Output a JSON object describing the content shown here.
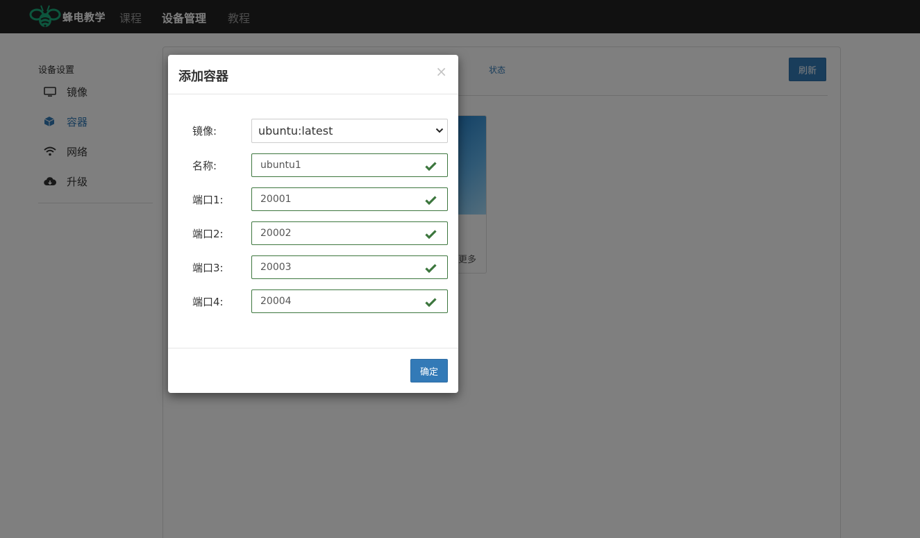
{
  "navbar": {
    "brand_text": "蜂电教学",
    "links": [
      "课程",
      "设备管理",
      "教程"
    ]
  },
  "sidebar": {
    "title": "设备设置",
    "items": [
      {
        "label": "镜像",
        "icon": "monitor-icon"
      },
      {
        "label": "容器",
        "icon": "cube-icon"
      },
      {
        "label": "网络",
        "icon": "wifi-icon"
      },
      {
        "label": "升级",
        "icon": "cloud-download-icon"
      }
    ]
  },
  "main": {
    "status_tab": "状态",
    "refresh_label": "刷新",
    "card_more": "更多"
  },
  "modal": {
    "title": "添加容器",
    "close": "×",
    "fields": {
      "image": {
        "label": "镜像:",
        "value": "ubuntu:latest"
      },
      "name": {
        "label": "名称:",
        "value": "ubuntu1"
      },
      "port1": {
        "label": "端口1:",
        "value": "20001"
      },
      "port2": {
        "label": "端口2:",
        "value": "20002"
      },
      "port3": {
        "label": "端口3:",
        "value": "20003"
      },
      "port4": {
        "label": "端口4:",
        "value": "20004"
      }
    },
    "ok_label": "确定"
  },
  "colors": {
    "navbar_bg": "#222222",
    "primary": "#337ab7",
    "success": "#3c763d",
    "brand_green": "#1aaa7a"
  }
}
